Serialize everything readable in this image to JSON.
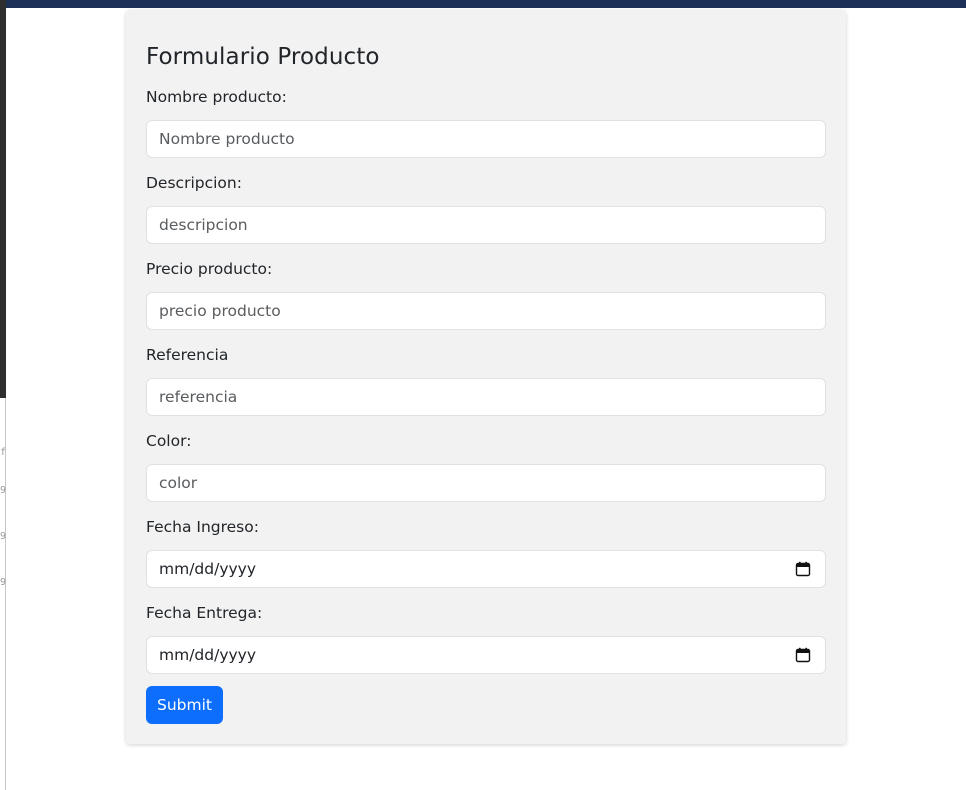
{
  "form": {
    "title": "Formulario Producto",
    "submit_label": "Submit",
    "fields": [
      {
        "label": "Nombre producto:",
        "placeholder": "Nombre producto",
        "value": ""
      },
      {
        "label": "Descripcion:",
        "placeholder": "descripcion",
        "value": ""
      },
      {
        "label": "Precio producto:",
        "placeholder": "precio producto",
        "value": ""
      },
      {
        "label": "Referencia",
        "placeholder": "referencia",
        "value": ""
      },
      {
        "label": "Color:",
        "placeholder": "color",
        "value": ""
      }
    ],
    "dates": [
      {
        "label": "Fecha Ingreso:",
        "display": "mm/dd/yyyy",
        "icon": "calendar-icon"
      },
      {
        "label": "Fecha Entrega:",
        "display": "mm/dd/yyyy",
        "icon": "calendar-icon"
      }
    ]
  },
  "colors": {
    "top_bar": "#1c3155",
    "card_background": "#f2f2f2",
    "primary_button": "#0d6efd"
  },
  "side_panel": {
    "ticks": [
      "f",
      "9",
      "9",
      "9"
    ]
  }
}
